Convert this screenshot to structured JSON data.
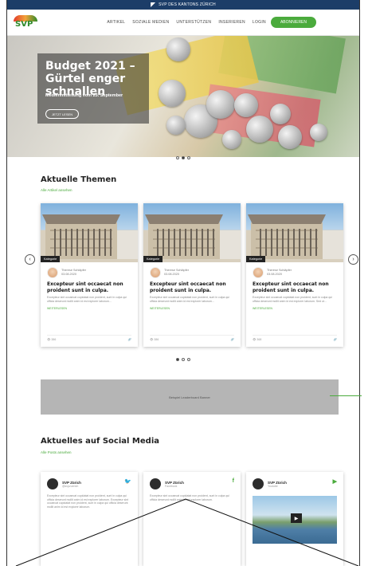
{
  "topbar": {
    "text": "SVP DES KANTONS ZÜRICH"
  },
  "nav": {
    "logo_text": "SVP",
    "items": [
      "ARTIKEL",
      "SOZIALE MEDIEN",
      "UNTERSTÜTZEN",
      "INSERIEREN",
      "LOGIN"
    ],
    "cta": "ABONNIEREN"
  },
  "hero": {
    "title": "Budget 2021 – Gürtel enger schnallen",
    "subtitle": "Medienmitteilung vom 23. September",
    "button": "JETZT LESEN"
  },
  "themen": {
    "title": "Aktuelle Themen",
    "link": "Alle Artikel ansehen",
    "cards": [
      {
        "category": "Kategorie",
        "author": "Therese Schläpfer",
        "date": "03.08.2020",
        "title": "Excepteur sint occaecat non proident sunt in culpa.",
        "excerpt": "Excepteur sint occaecat cupidatat non proident, sunt in culpa qui officia deserunt mollit anim id est explorer laborum...",
        "more": "WEITERLESEN",
        "views": "386"
      },
      {
        "category": "Kategorie",
        "author": "Therese Schläpfer",
        "date": "03.08.2020",
        "title": "Excepteur sint occaecat non proident sunt in culpa.",
        "excerpt": "Excepteur sint occaecat cupidatat non proident, sunt in culpa qui officia deserunt mollit anim id est explorer laborum...",
        "more": "WEITERLESEN",
        "views": "386"
      },
      {
        "category": "Kategorie",
        "author": "Therese Schläpfer",
        "date": "03.08.2020",
        "title": "Excepteur sint occaecat non proident sunt in culpa.",
        "excerpt": "Excepteur sint occaecat cupidatat non proident, sunt in culpa qui officia deserunt mollit anim id est explorer laborum. Sed ut...",
        "more": "WEITERLESEN",
        "views": "368"
      }
    ]
  },
  "banner": {
    "text": "Beispiel Leaderboard Banner"
  },
  "social": {
    "title": "Aktuelles auf Social Media",
    "link": "Alle Posts ansehen",
    "cards": [
      {
        "name": "SVP Zürich",
        "handle": "@svpzuerich",
        "icon": "twitter-icon",
        "glyph": "🐦",
        "text": "Excepteur sint occaecat cupidatat non proident, sunt in culpa qui officia deserunt mollit anim id est explorer laborum. Excepteur sint occaecat cupidatat non proident, sunt in culpa qui officia deserunt mollit anim id est explorer laborum."
      },
      {
        "name": "SVP Zürich",
        "handle": "Facebook",
        "icon": "facebook-icon",
        "glyph": "f",
        "text": "Excepteur sint occaecat cupidatat non proident, sunt in culpa qui officia deserunt mollit anim id est explorer laborum."
      },
      {
        "name": "SVP Zürich",
        "handle": "Youtube",
        "icon": "youtube-icon",
        "glyph": "▶"
      }
    ]
  },
  "colors": {
    "brand_green": "#4bab3d",
    "topbar_blue": "#1c3d68"
  }
}
